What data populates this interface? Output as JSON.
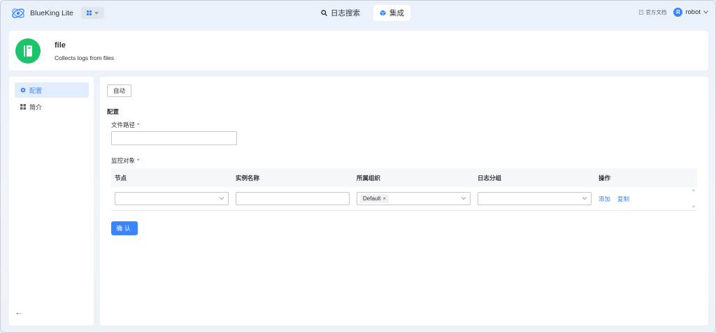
{
  "header": {
    "brand": "BlueKing Lite",
    "nav": [
      {
        "label": "日志搜索",
        "icon": "search-icon",
        "active": false
      },
      {
        "label": "集成",
        "icon": "cube-icon",
        "active": true
      }
    ],
    "doc_label": "官方文档",
    "user_initial": "R",
    "user_name": "robot"
  },
  "plugin": {
    "name": "file",
    "description": "Collects logs from files",
    "icon_color": "#1ac46a"
  },
  "side_menu": {
    "items": [
      {
        "label": "配置",
        "icon": "gear-icon",
        "active": true
      },
      {
        "label": "简介",
        "icon": "grid-icon",
        "active": false
      }
    ]
  },
  "main": {
    "mode_button": "自动",
    "section_title": "配置",
    "file_path_label": "文件路径",
    "file_path_value": "",
    "monitor_label": "监控对象",
    "required_mark": "*",
    "table": {
      "headers": [
        "节点",
        "实例名称",
        "所属组织",
        "日志分组",
        "操作"
      ],
      "row": {
        "node": "",
        "instance_name": "",
        "org_tag": "Default",
        "log_group": "",
        "actions": [
          "添加",
          "复制"
        ]
      }
    },
    "confirm_label": "确认"
  },
  "colors": {
    "accent": "#3a84ff",
    "plugin_green": "#1ac46a",
    "required": "#ea3636"
  }
}
